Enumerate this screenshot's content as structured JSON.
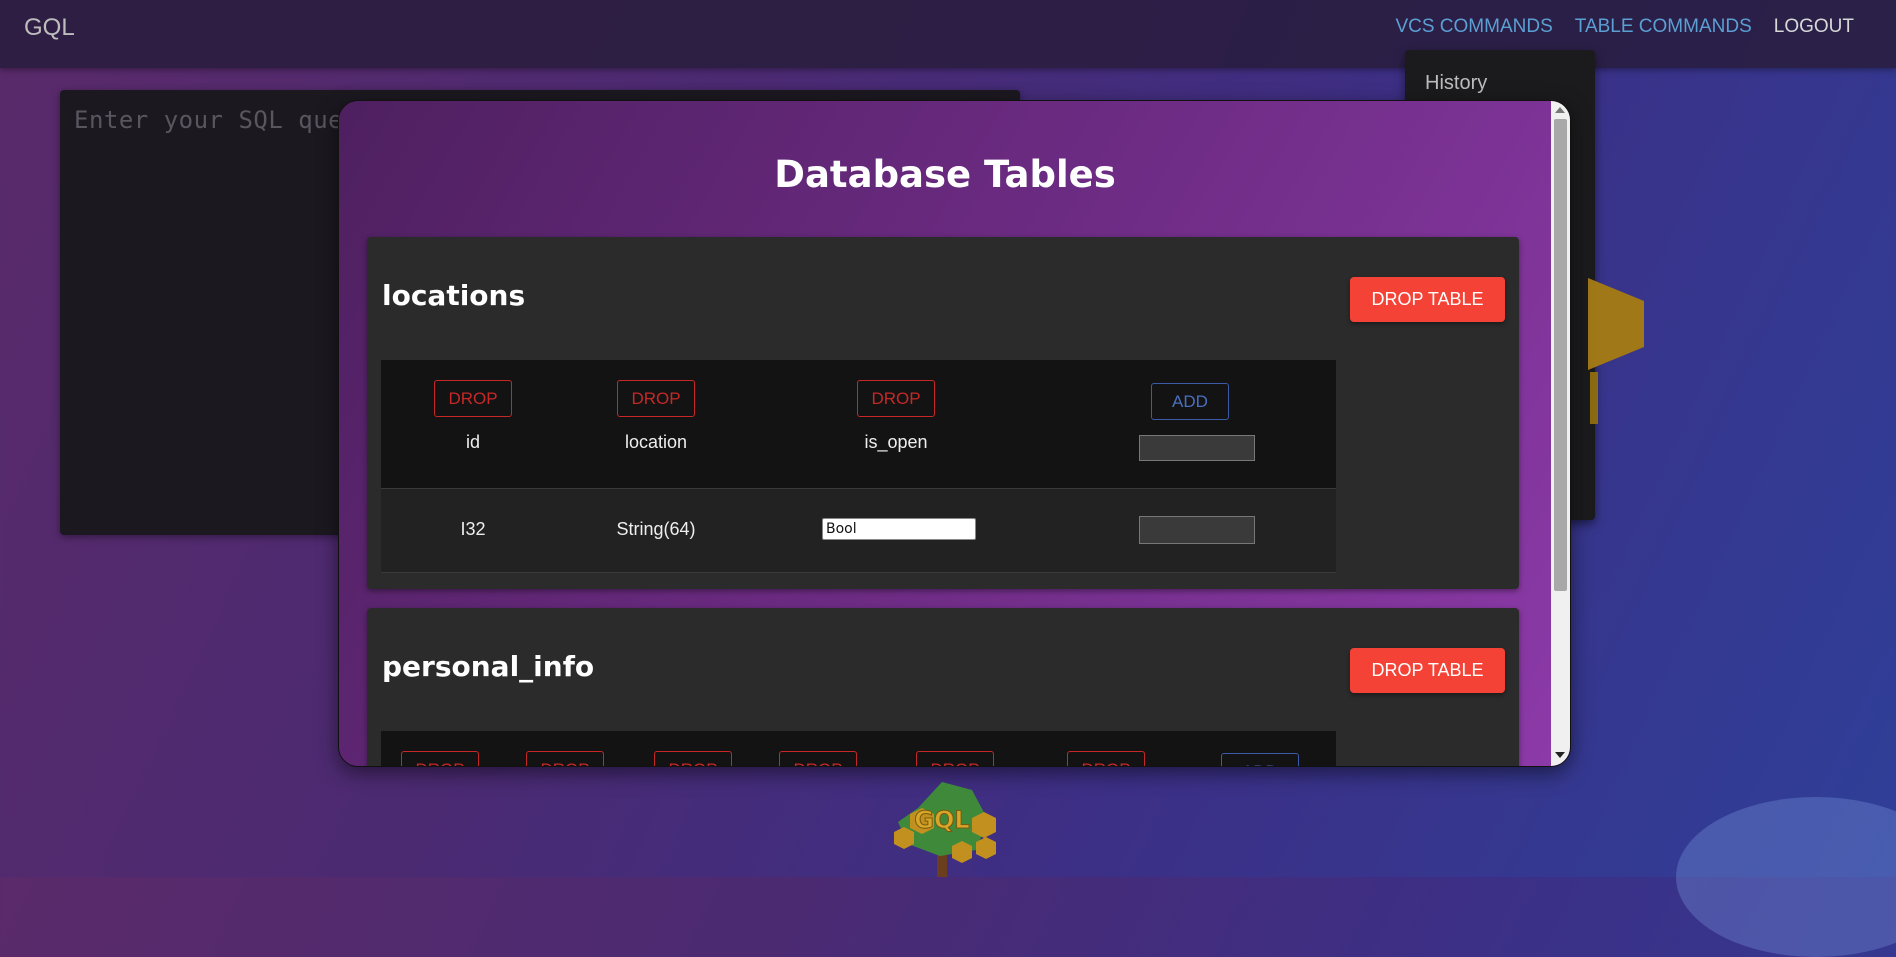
{
  "navbar": {
    "brand": "GQL",
    "links": [
      "VCS COMMANDS",
      "TABLE COMMANDS",
      "LOGOUT"
    ]
  },
  "dropdown": {
    "items": [
      "History"
    ]
  },
  "query": {
    "placeholder": "Enter your SQL query"
  },
  "modal": {
    "title": "Database Tables",
    "tables": [
      {
        "name": "locations",
        "drop_label": "DROP TABLE",
        "column_drop_label": "DROP",
        "add_label": "ADD",
        "columns": [
          "id",
          "location",
          "is_open"
        ],
        "types": [
          "I32",
          "String(64)",
          "Bool"
        ]
      },
      {
        "name": "personal_info",
        "drop_label": "DROP TABLE",
        "column_drop_label": "DROP",
        "add_label": "ADD"
      }
    ]
  },
  "logo": {
    "text": "GQL"
  },
  "colors": {
    "accent": "#f44336",
    "link": "#5c9fd3",
    "add": "#4a6fc0",
    "drop": "#c62828"
  }
}
